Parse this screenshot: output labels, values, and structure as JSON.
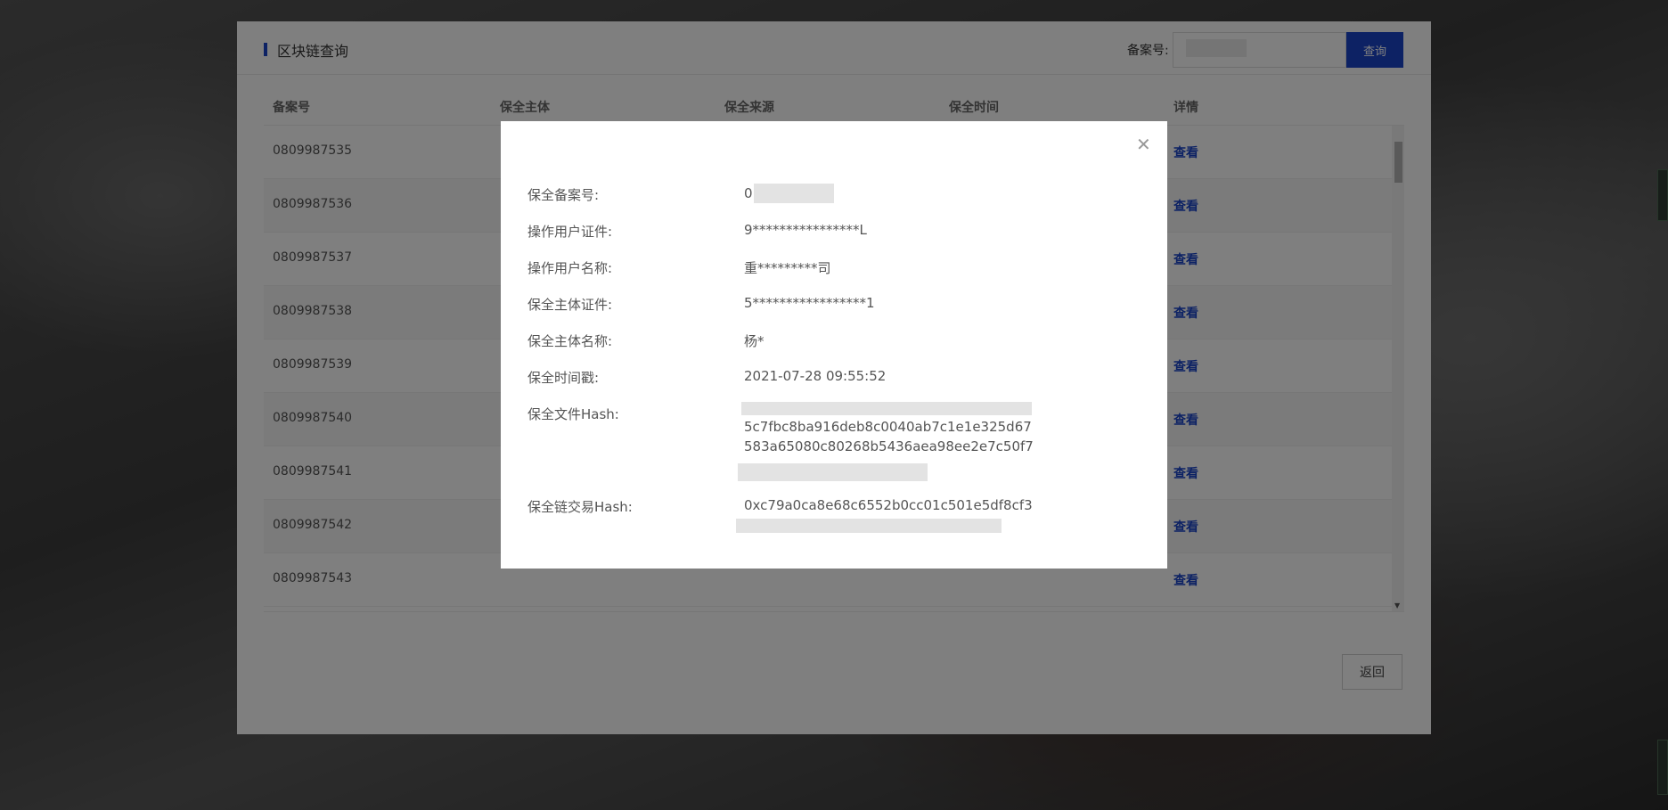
{
  "panel": {
    "title": "区块链查询",
    "search_label": "备案号:",
    "search_value": "",
    "search_button": "查询",
    "back_button": "返回"
  },
  "table": {
    "headers": [
      "备案号",
      "保全主体",
      "保全来源",
      "保全时间",
      "详情"
    ],
    "rows": [
      {
        "id": "0809987535",
        "action": "查看"
      },
      {
        "id": "0809987536",
        "action": "查看"
      },
      {
        "id": "0809987537",
        "action": "查看"
      },
      {
        "id": "0809987538",
        "action": "查看"
      },
      {
        "id": "0809987539",
        "action": "查看"
      },
      {
        "id": "0809987540",
        "action": "查看"
      },
      {
        "id": "0809987541",
        "action": "查看"
      },
      {
        "id": "0809987542",
        "action": "查看"
      },
      {
        "id": "0809987543",
        "action": "查看"
      }
    ]
  },
  "modal": {
    "fields": [
      {
        "label": "保全备案号:",
        "value": "0"
      },
      {
        "label": "操作用户证件:",
        "value": "9****************L"
      },
      {
        "label": "操作用户名称:",
        "value": "重*********司"
      },
      {
        "label": "保全主体证件:",
        "value": "5*****************1"
      },
      {
        "label": "保全主体名称:",
        "value": "杨*"
      },
      {
        "label": "保全时间戳:",
        "value": "2021-07-28 09:55:52"
      }
    ],
    "file_hash_label": "保全文件Hash:",
    "file_hash_lines": [
      "5c7fbc8ba916deb8c0040ab7c1e1e325d67",
      "583a65080c80268b5436aea98ee2e7c50f7"
    ],
    "tx_hash_label": "保全链交易Hash:",
    "tx_hash_line": "0xc79a0ca8e68c6552b0cc01c501e5df8cf3"
  },
  "colors": {
    "accent": "#1a44c9",
    "overlay": "rgba(0,0,0,0.5)"
  }
}
